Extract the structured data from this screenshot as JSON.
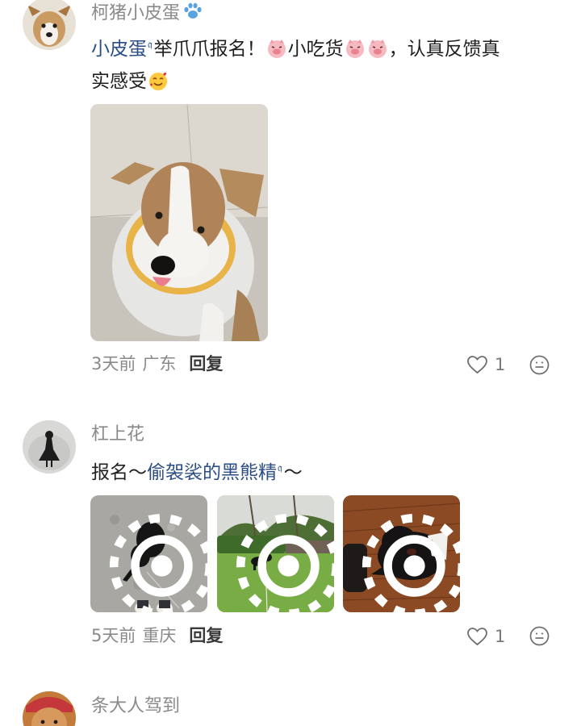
{
  "comments": [
    {
      "username": "柯猪小皮蛋",
      "mention": "小皮蛋",
      "text_part1": "举爪爪报名！",
      "text_part2": "小吃货",
      "text_part3": "，认真反馈真",
      "text_part4": "实感受",
      "time": "3天前",
      "location": "广东",
      "reply_label": "回复",
      "likes": "1"
    },
    {
      "username": "杠上花",
      "text_part1": "报名～",
      "mention": "偷袈裟的黑熊精",
      "text_part2": "～",
      "time": "5天前",
      "location": "重庆",
      "reply_label": "回复",
      "likes": "1"
    },
    {
      "username": "条大人驾到"
    }
  ],
  "icons": {
    "like": "heart-outline-icon",
    "react": "smiley-face-icon",
    "live_photo": "live-photo-icon",
    "mention_marker": "search-mention-icon",
    "paw": "paw-icon"
  },
  "colors": {
    "mention": "#2b4d86",
    "meta": "#8a8a8a",
    "text": "#1f1f1f"
  }
}
